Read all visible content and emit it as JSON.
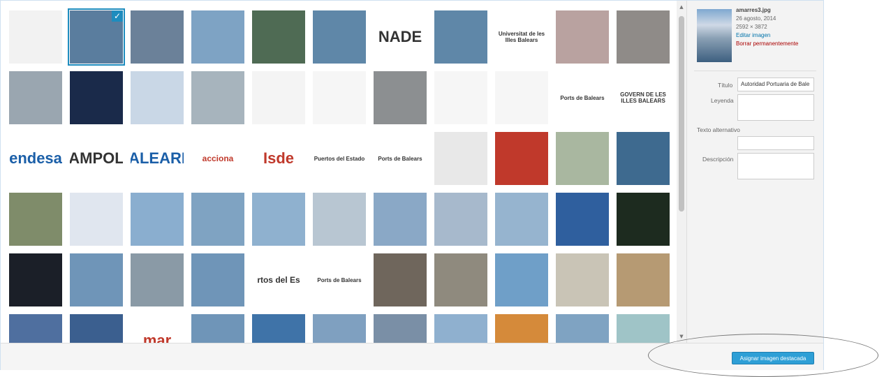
{
  "thumbnails": [
    {
      "color": "#f2f2f2",
      "text": ""
    },
    {
      "color": "#5a7d9e",
      "text": ""
    },
    {
      "color": "#6b8199",
      "text": ""
    },
    {
      "color": "#7ea3c4",
      "text": ""
    },
    {
      "color": "#4f6b54",
      "text": ""
    },
    {
      "color": "#5f87a8",
      "text": ""
    },
    {
      "color": "#ffffff",
      "text": "NADE"
    },
    {
      "color": "#5f87a8",
      "text": ""
    },
    {
      "color": "#ffffff",
      "text": "Universitat de les Illes Balears"
    },
    {
      "color": "#b9a2a0",
      "text": ""
    },
    {
      "color": "#8f8b88",
      "text": ""
    },
    {
      "color": "#9aa6b0",
      "text": ""
    },
    {
      "color": "#1a2a4a",
      "text": ""
    },
    {
      "color": "#c9d7e6",
      "text": ""
    },
    {
      "color": "#a7b4bd",
      "text": ""
    },
    {
      "color": "#f4f4f4",
      "text": ""
    },
    {
      "color": "#f6f6f6",
      "text": ""
    },
    {
      "color": "#8c8f91",
      "text": ""
    },
    {
      "color": "#f6f6f6",
      "text": ""
    },
    {
      "color": "#f6f6f6",
      "text": ""
    },
    {
      "color": "#ffffff",
      "text": "Ports de Balears"
    },
    {
      "color": "#ffffff",
      "text": "GOVERN DE LES ILLES BALEARS"
    },
    {
      "color": "#ffffff",
      "text": "endesa"
    },
    {
      "color": "#ffffff",
      "text": "AMPOL"
    },
    {
      "color": "#ffffff",
      "text": "ALEARI"
    },
    {
      "color": "#ffffff",
      "text": "acciona"
    },
    {
      "color": "#ffffff",
      "text": "Isde"
    },
    {
      "color": "#ffffff",
      "text": "Puertos del Estado"
    },
    {
      "color": "#ffffff",
      "text": "Ports de Balears"
    },
    {
      "color": "#e8e8e8",
      "text": ""
    },
    {
      "color": "#c0392b",
      "text": ""
    },
    {
      "color": "#a9b7a0",
      "text": ""
    },
    {
      "color": "#3e6a8f",
      "text": ""
    },
    {
      "color": "#7f8c6a",
      "text": ""
    },
    {
      "color": "#e0e6ef",
      "text": ""
    },
    {
      "color": "#8aaecf",
      "text": ""
    },
    {
      "color": "#7fa3c2",
      "text": ""
    },
    {
      "color": "#8fb1cf",
      "text": ""
    },
    {
      "color": "#b8c6d2",
      "text": ""
    },
    {
      "color": "#8aa8c6",
      "text": ""
    },
    {
      "color": "#a7b9cc",
      "text": ""
    },
    {
      "color": "#96b4cf",
      "text": ""
    },
    {
      "color": "#2f5f9e",
      "text": ""
    },
    {
      "color": "#1d2b1f",
      "text": ""
    },
    {
      "color": "#1b1f28",
      "text": ""
    },
    {
      "color": "#6f95b8",
      "text": ""
    },
    {
      "color": "#8a9aa6",
      "text": ""
    },
    {
      "color": "#6f95b8",
      "text": ""
    },
    {
      "color": "#ffffff",
      "text": "rtos del Es"
    },
    {
      "color": "#ffffff",
      "text": "Ports de Balears"
    },
    {
      "color": "#6f665c",
      "text": ""
    },
    {
      "color": "#8f8a7e",
      "text": ""
    },
    {
      "color": "#6f9fc8",
      "text": ""
    },
    {
      "color": "#c9c4b6",
      "text": ""
    },
    {
      "color": "#b69a73",
      "text": ""
    },
    {
      "color": "#4f6f9f",
      "text": ""
    },
    {
      "color": "#3b5f8f",
      "text": ""
    },
    {
      "color": "#ffffff",
      "text": "mar"
    },
    {
      "color": "#6f95b8",
      "text": ""
    },
    {
      "color": "#3f73a8",
      "text": ""
    },
    {
      "color": "#7fa0c0",
      "text": ""
    },
    {
      "color": "#7a8fa6",
      "text": ""
    },
    {
      "color": "#8fb0cf",
      "text": ""
    },
    {
      "color": "#d58a3a",
      "text": ""
    },
    {
      "color": "#7fa3c2",
      "text": ""
    },
    {
      "color": "#9fc4c7",
      "text": ""
    }
  ],
  "details": {
    "filename": "amarres3.jpg",
    "date": "26 agosto, 2014",
    "dimensions": "2592 × 3872",
    "edit_link": "Editar imagen",
    "delete_link": "Borrar permanentemente",
    "title_label": "Título",
    "title_value": "Autoridad Portuaria de Bale",
    "caption_label": "Leyenda",
    "caption_value": "",
    "alt_label": "Texto alternativo",
    "alt_value": "",
    "description_label": "Descripción",
    "description_value": ""
  },
  "footer": {
    "button_label": "Asignar imagen destacada"
  },
  "selected_index": 1
}
